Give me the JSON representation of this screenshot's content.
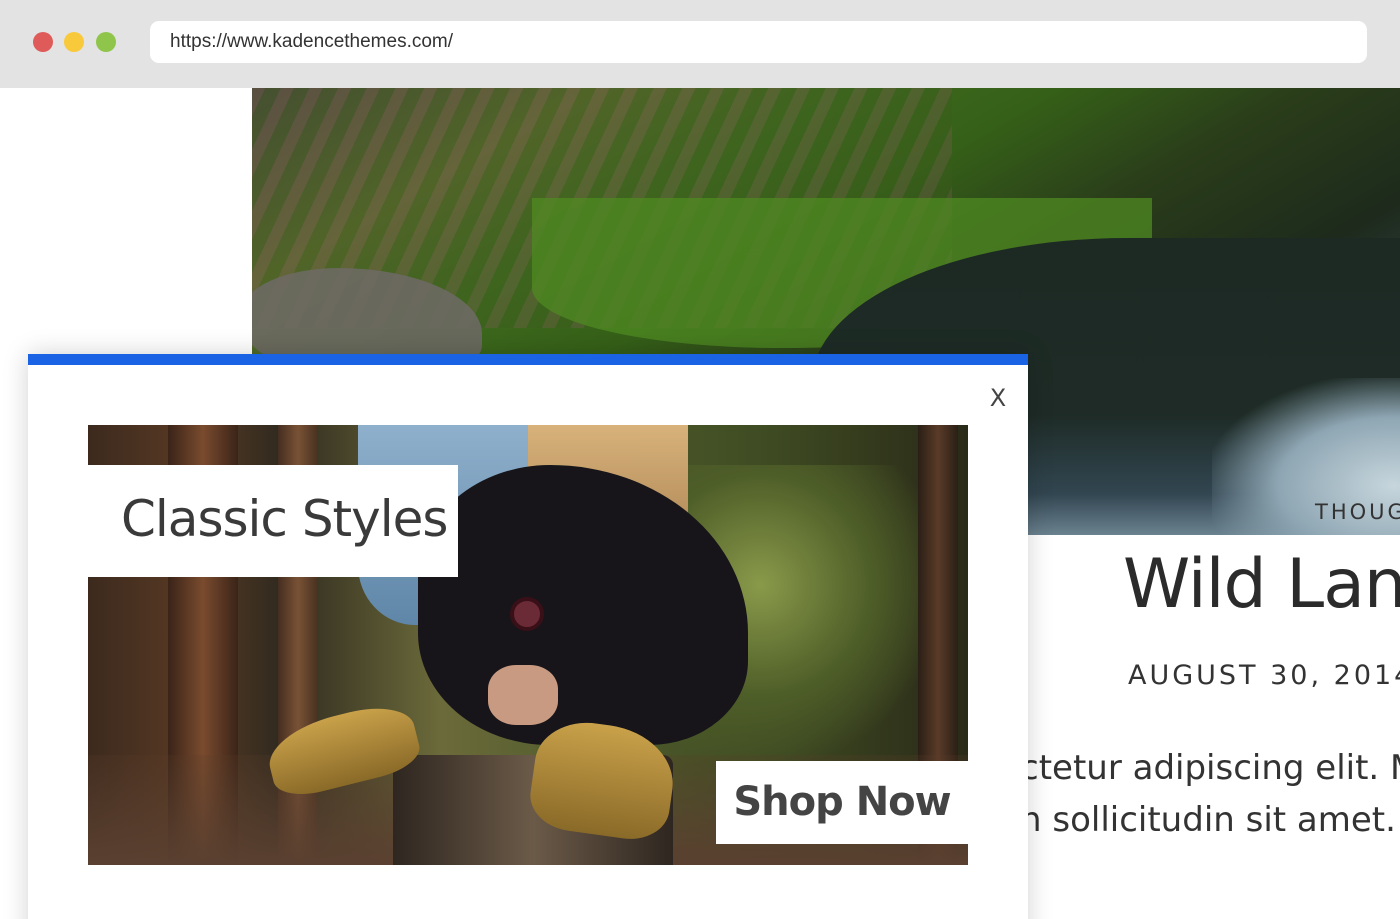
{
  "browser": {
    "url": "https://www.kadencethemes.com/"
  },
  "post": {
    "category": "THOUG",
    "title": "Wild Lanc",
    "date": "AUGUST 30, 2014",
    "excerpt_line1": "ctetur adipiscing elit. Ma",
    "excerpt_line2": "n sollicitudin sit amet. P"
  },
  "popup": {
    "close_label": "X",
    "accent_color": "#1b63e5",
    "promo_title": "Classic Styles",
    "shop_button_label": "Shop Now"
  }
}
